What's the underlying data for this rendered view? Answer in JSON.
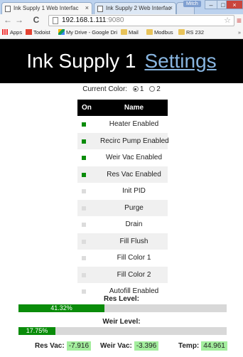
{
  "browser": {
    "tabs": [
      {
        "title": "Ink Supply 1 Web Interfac",
        "close": "×",
        "active": true
      },
      {
        "title": "Ink Supply 2 Web Interfac",
        "close": "×",
        "active": false
      }
    ],
    "user": "Mitch",
    "window_controls": {
      "minimize": "–",
      "maximize": "□",
      "close": "×"
    },
    "address": {
      "host": "192.168.1.111",
      "port": ":9080"
    },
    "bookmarks": [
      "Apps",
      "Todoist",
      "My Drive - Google Dri",
      "Mail",
      "Modbus",
      "RS 232"
    ],
    "bookmarks_more": "»"
  },
  "header": {
    "title": "Ink Supply 1",
    "settings_link": "Settings"
  },
  "current_color": {
    "label": "Current Color:",
    "options": [
      "1",
      "2"
    ],
    "selected": "1"
  },
  "table": {
    "headers": {
      "on": "On",
      "name": "Name"
    },
    "rows": [
      {
        "name": "Heater Enabled",
        "on": true
      },
      {
        "name": "Recirc Pump Enabled",
        "on": true
      },
      {
        "name": "Weir Vac Enabled",
        "on": true
      },
      {
        "name": "Res Vac Enabled",
        "on": true
      },
      {
        "name": "Init PID",
        "on": false
      },
      {
        "name": "Purge",
        "on": false
      },
      {
        "name": "Drain",
        "on": false
      },
      {
        "name": "Fill Flush",
        "on": false
      },
      {
        "name": "Fill Color 1",
        "on": false
      },
      {
        "name": "Fill Color 2",
        "on": false
      },
      {
        "name": "Autofill Enabled",
        "on": false
      }
    ]
  },
  "levels": {
    "res": {
      "label": "Res Level:",
      "percent": 41.32,
      "text": "41.32%"
    },
    "weir": {
      "label": "Weir Level:",
      "percent": 17.75,
      "text": "17.75%"
    }
  },
  "readouts": {
    "res_vac": {
      "label": "Res Vac:",
      "value": "-7.916"
    },
    "weir_vac": {
      "label": "Weir Vac:",
      "value": "-3.396"
    },
    "temp": {
      "label": "Temp:",
      "value": "44.961"
    }
  },
  "colors": {
    "on": "#0a8c0a",
    "off": "#dcdcdc",
    "readout_bg": "#a4ee9e",
    "header_bg": "#000000",
    "link": "#88b5e0"
  },
  "icons": {
    "back": "back-arrow-icon",
    "forward": "forward-arrow-icon",
    "reload": "reload-icon",
    "bookmark_star": "star-icon",
    "menu": "hamburger-menu-icon"
  }
}
